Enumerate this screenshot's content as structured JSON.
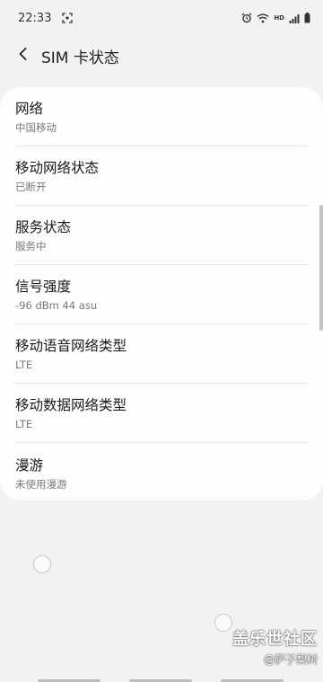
{
  "status_bar": {
    "time": "22:33",
    "hd_label": "HD"
  },
  "header": {
    "title": "SIM 卡状态"
  },
  "items": [
    {
      "title": "网络",
      "value": "中国移动"
    },
    {
      "title": "移动网络状态",
      "value": "已断开"
    },
    {
      "title": "服务状态",
      "value": "服务中"
    },
    {
      "title": "信号强度",
      "value": "-96 dBm 44 asu"
    },
    {
      "title": "移动语音网络类型",
      "value": "LTE"
    },
    {
      "title": "移动数据网络类型",
      "value": "LTE"
    },
    {
      "title": "漫游",
      "value": "未使用漫游"
    }
  ],
  "watermark": {
    "main": "盖乐世社区",
    "sub": "@萨子梨树"
  },
  "icons": {
    "screenshot": "screenshot-icon",
    "alarm": "alarm-icon",
    "wifi": "wifi-icon",
    "signal": "signal-icon",
    "battery": "battery-icon",
    "back": "back-arrow-icon"
  },
  "colors": {
    "background": "#f2f2f2",
    "card": "#fdfdfd",
    "title_text": "#1a1a1a",
    "subtitle_text": "#7a7a7a"
  }
}
